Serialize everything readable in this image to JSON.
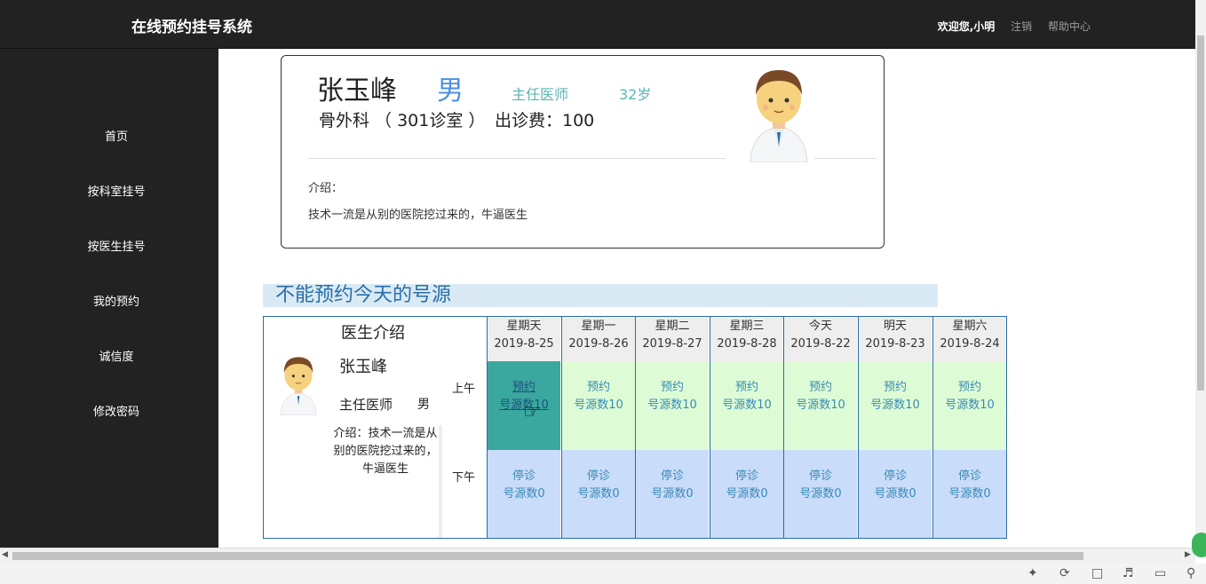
{
  "header": {
    "brand": "在线预约挂号系统",
    "welcome": "欢迎您,小明",
    "logout": "注销",
    "help": "帮助中心"
  },
  "sidebar": {
    "items": [
      {
        "label": "首页"
      },
      {
        "label": "按科室挂号"
      },
      {
        "label": "按医生挂号"
      },
      {
        "label": "我的预约"
      },
      {
        "label": "诚信度"
      },
      {
        "label": "修改密码"
      }
    ]
  },
  "doctor_card": {
    "name": "张玉峰",
    "gender": "男",
    "title": "主任医师",
    "age": "32岁",
    "dept": "骨外科 （ 301诊室 ）",
    "fee": "出诊费：100",
    "intro_label": "介绍：",
    "intro_text": "技术一流是从别的医院挖过来的，牛逼医生"
  },
  "schedule": {
    "section_title": "不能预约今天的号源",
    "heading": "医生介绍",
    "name": "张玉峰",
    "title": "主任医师",
    "gender": "男",
    "intro": "介绍：技术一流是从别的医院挖过来的，牛逼医生",
    "am_label": "上午",
    "pm_label": "下午",
    "days": [
      {
        "weekday": "星期天",
        "date": "2019-8-25",
        "am_status": "预约",
        "am_count": "号源数10",
        "pm_status": "停诊",
        "pm_count": "号源数0"
      },
      {
        "weekday": "星期一",
        "date": "2019-8-26",
        "am_status": "预约",
        "am_count": "号源数10",
        "pm_status": "停诊",
        "pm_count": "号源数0"
      },
      {
        "weekday": "星期二",
        "date": "2019-8-27",
        "am_status": "预约",
        "am_count": "号源数10",
        "pm_status": "停诊",
        "pm_count": "号源数0"
      },
      {
        "weekday": "星期三",
        "date": "2019-8-28",
        "am_status": "预约",
        "am_count": "号源数10",
        "pm_status": "停诊",
        "pm_count": "号源数0"
      },
      {
        "weekday": "今天",
        "date": "2019-8-22",
        "am_status": "预约",
        "am_count": "号源数10",
        "pm_status": "停诊",
        "pm_count": "号源数0"
      },
      {
        "weekday": "明天",
        "date": "2019-8-23",
        "am_status": "预约",
        "am_count": "号源数10",
        "pm_status": "停诊",
        "pm_count": "号源数0"
      },
      {
        "weekday": "星期六",
        "date": "2019-8-24",
        "am_status": "预约",
        "am_count": "号源数10",
        "pm_status": "停诊",
        "pm_count": "号源数0"
      }
    ]
  },
  "colors": {
    "topbar": "#222222",
    "available": "#ddfcd5",
    "active": "#3aa89f",
    "closed": "#c9dcf9",
    "accent": "#2a6ea6"
  },
  "icons": [
    "doctor-avatar-icon",
    "hand-pointer-cursor-icon",
    "pin-icon",
    "refresh-icon",
    "trash-icon",
    "speaker-icon",
    "window-icon",
    "search-icon"
  ]
}
